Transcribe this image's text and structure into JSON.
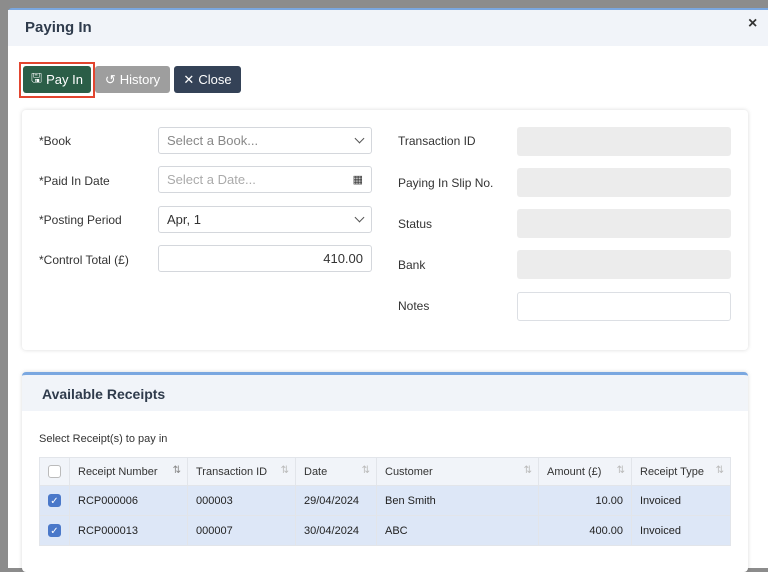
{
  "modal": {
    "title": "Paying In",
    "close_icon": "×"
  },
  "toolbar": {
    "pay_in": "Pay In",
    "history": "History",
    "close": "Close"
  },
  "form": {
    "book_label": "*Book",
    "book_placeholder": "Select a Book...",
    "date_label": "*Paid In Date",
    "date_placeholder": "Select a Date...",
    "period_label": "*Posting Period",
    "period_value": "Apr, 1",
    "control_label": "*Control Total (£)",
    "control_value": "410.00",
    "txn_label": "Transaction ID",
    "slip_label": "Paying In Slip No.",
    "status_label": "Status",
    "bank_label": "Bank",
    "notes_label": "Notes"
  },
  "receipts": {
    "title": "Available Receipts",
    "hint": "Select Receipt(s) to pay in",
    "columns": [
      "Receipt Number",
      "Transaction ID",
      "Date",
      "Customer",
      "Amount (£)",
      "Receipt Type"
    ],
    "rows": [
      {
        "checked": true,
        "receipt": "RCP000006",
        "txn": "000003",
        "date": "29/04/2024",
        "customer": "Ben Smith",
        "amount": "10.00",
        "type": "Invoiced"
      },
      {
        "checked": true,
        "receipt": "RCP000013",
        "txn": "000007",
        "date": "30/04/2024",
        "customer": "ABC",
        "amount": "400.00",
        "type": "Invoiced"
      }
    ]
  }
}
